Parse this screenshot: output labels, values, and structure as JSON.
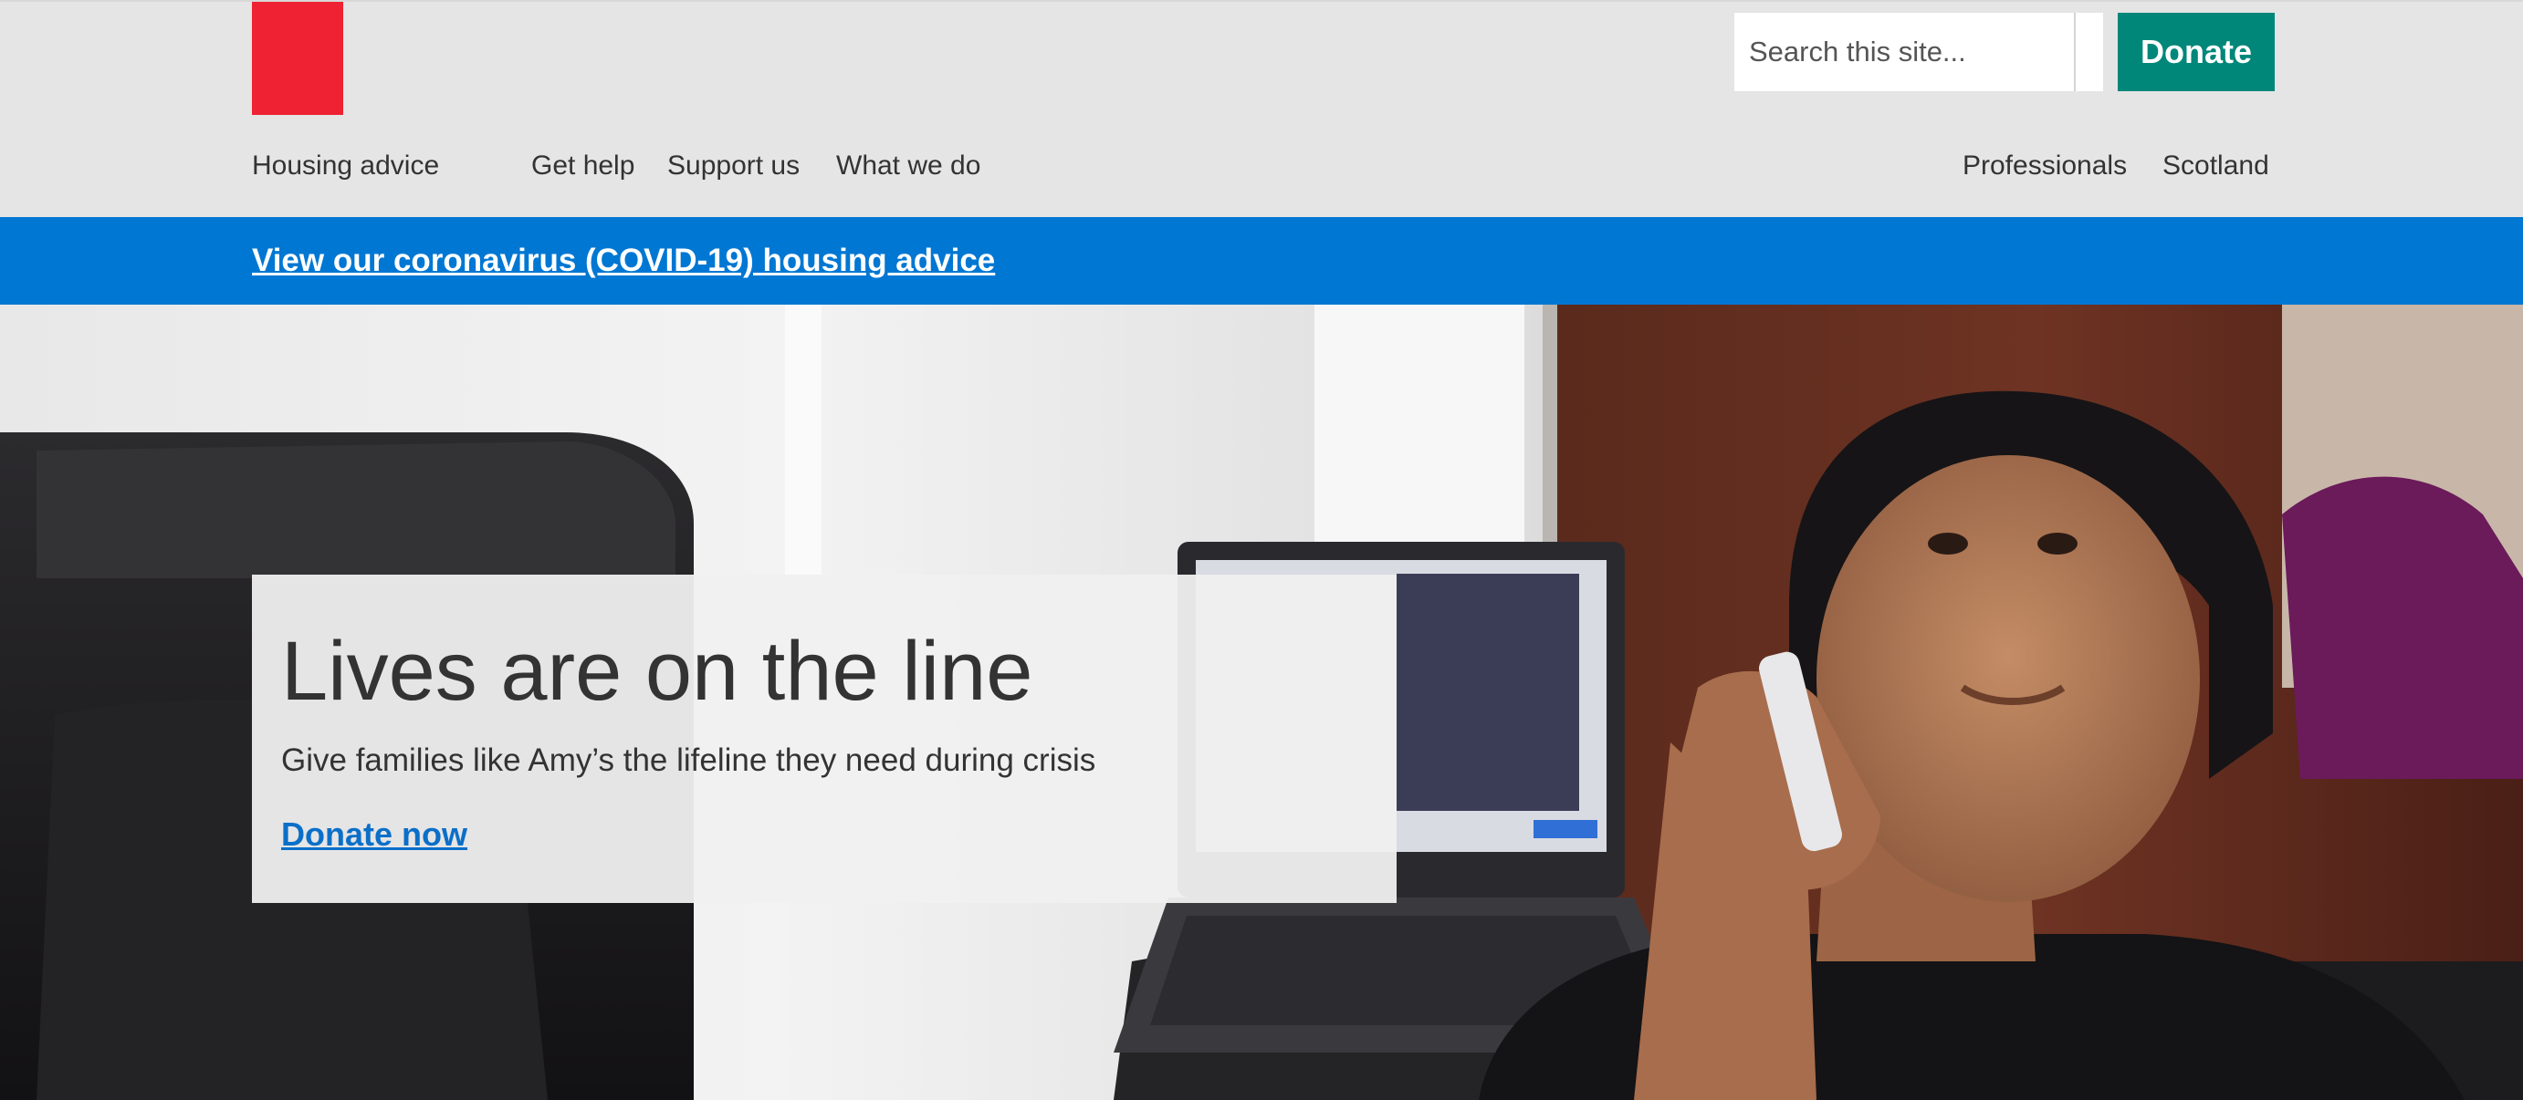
{
  "header": {
    "search_placeholder": "Search this site...",
    "donate_label": "Donate",
    "nav_left": [
      "Housing advice",
      "Get help",
      "Support us",
      "What we do"
    ],
    "nav_right": [
      "Professionals",
      "Scotland"
    ]
  },
  "banner": {
    "link_text": "View our coronavirus (COVID-19) housing advice"
  },
  "hero": {
    "heading": "Lives are on the line",
    "subheading": "Give families like Amy’s the lifeline they need during crisis",
    "cta_label": "Donate now"
  },
  "colors": {
    "logo_red": "#ee2233",
    "donate_teal": "#00877a",
    "banner_blue": "#0077d3",
    "link_blue": "#0b6fc8",
    "header_grey": "#e5e5e5"
  },
  "icons": {
    "logo": "red-square-logo"
  }
}
